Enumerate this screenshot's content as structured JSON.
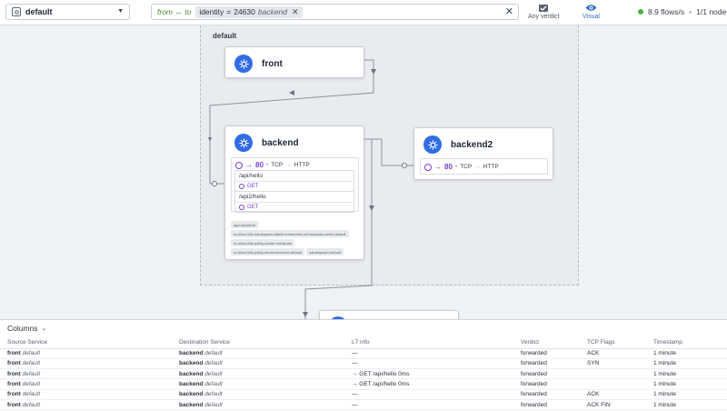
{
  "namespace_select": {
    "value": "default"
  },
  "filter": {
    "direction": "from ↔ to",
    "tag_key": "identity",
    "tag_op": "=",
    "tag_value": "24630",
    "tag_name": "backend"
  },
  "toolbar": {
    "verdict_label": "Any verdict",
    "visual_label": "Visual",
    "flows_rate": "8.9 flows/s",
    "nodes": "1/1 nodes"
  },
  "map": {
    "namespace_label": "default",
    "services": {
      "front": {
        "name": "front"
      },
      "backend": {
        "name": "backend",
        "port": {
          "number": "80",
          "protocol": "TCP",
          "app_protocol": "HTTP"
        },
        "routes": [
          {
            "path": "/api/hello",
            "method": "GET"
          },
          {
            "path": "/api2/hello",
            "method": "GET"
          }
        ],
        "labels": [
          "app=backend",
          "io.cilium.k8s.namespace.labels.kubernetes.io/metadata.name=default",
          "io.cilium.k8s.policy.cluster=minikube",
          "io.cilium.k8s.policy.serviceaccount=default",
          "namespace=default"
        ]
      },
      "backend2": {
        "name": "backend2",
        "port": {
          "number": "80",
          "protocol": "TCP",
          "app_protocol": "HTTP"
        }
      }
    }
  },
  "flows_panel": {
    "columns_toggle": "Columns",
    "headers": [
      "Source Service",
      "Destination Service",
      "L7 info",
      "Verdict",
      "TCP Flags",
      "Timestamp"
    ],
    "rows": [
      {
        "src": "front",
        "src_ns": "default",
        "dst": "backend",
        "dst_ns": "default",
        "l7": "—",
        "verdict": "forwarded",
        "flags": "ACK",
        "time": "1 minute"
      },
      {
        "src": "front",
        "src_ns": "default",
        "dst": "backend",
        "dst_ns": "default",
        "l7": "—",
        "verdict": "forwarded",
        "flags": "SYN",
        "time": "1 minute"
      },
      {
        "src": "front",
        "src_ns": "default",
        "dst": "backend",
        "dst_ns": "default",
        "l7": "→ GET /api/hello 0ms",
        "verdict": "forwarded",
        "flags": "",
        "time": "1 minute"
      },
      {
        "src": "front",
        "src_ns": "default",
        "dst": "backend",
        "dst_ns": "default",
        "l7": "→ GET /api/hello 0ms",
        "verdict": "forwarded",
        "flags": "",
        "time": "1 minute"
      },
      {
        "src": "front",
        "src_ns": "default",
        "dst": "backend",
        "dst_ns": "default",
        "l7": "—",
        "verdict": "forwarded",
        "flags": "ACK",
        "time": "1 minute"
      },
      {
        "src": "front",
        "src_ns": "default",
        "dst": "backend",
        "dst_ns": "default",
        "l7": "—",
        "verdict": "forwarded",
        "flags": "ACK FIN",
        "time": "1 minute"
      }
    ]
  },
  "colors": {
    "accent": "#326ce5",
    "forwarded": "#5aa636",
    "l7": "#7b3fc8"
  }
}
